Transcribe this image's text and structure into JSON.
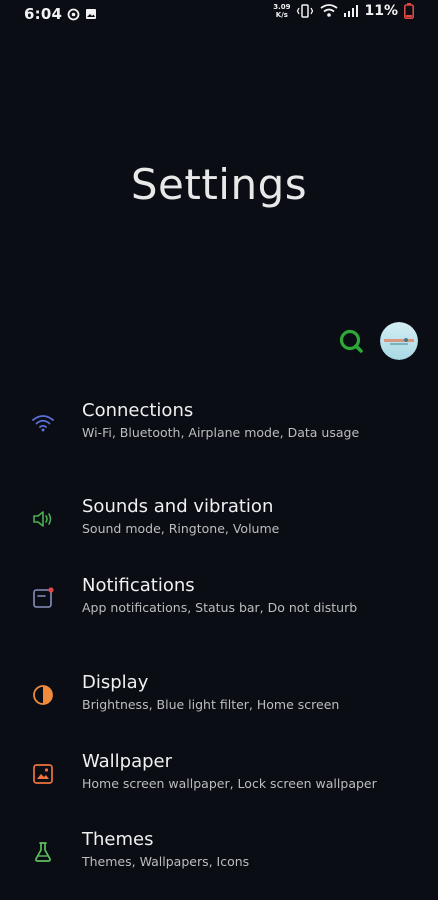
{
  "status_bar": {
    "time": "6:04",
    "net_speed_value": "3.09",
    "net_speed_unit": "K/s",
    "battery": "11%"
  },
  "page": {
    "title": "Settings"
  },
  "header_actions": {
    "search_icon": "search-icon",
    "avatar": "profile-avatar"
  },
  "settings": {
    "items": [
      {
        "title": "Connections",
        "subtitle": "Wi-Fi, Bluetooth, Airplane mode, Data usage",
        "icon": "wifi-icon",
        "color": "#5b6fd6"
      },
      {
        "title": "Sounds and vibration",
        "subtitle": "Sound mode, Ringtone, Volume",
        "icon": "speaker-icon",
        "color": "#4caf50"
      },
      {
        "title": "Notifications",
        "subtitle": "App notifications, Status bar, Do not disturb",
        "icon": "notification-icon",
        "color": "#8a8fc0"
      },
      {
        "title": "Display",
        "subtitle": "Brightness, Blue light filter, Home screen",
        "icon": "display-icon",
        "color": "#f08a3c"
      },
      {
        "title": "Wallpaper",
        "subtitle": "Home screen wallpaper, Lock screen wallpaper",
        "icon": "wallpaper-icon",
        "color": "#f0723c"
      },
      {
        "title": "Themes",
        "subtitle": "Themes, Wallpapers, Icons",
        "icon": "themes-icon",
        "color": "#5cc15c"
      }
    ]
  },
  "colors": {
    "background": "#0a0d14",
    "search_accent": "#2ea836"
  }
}
